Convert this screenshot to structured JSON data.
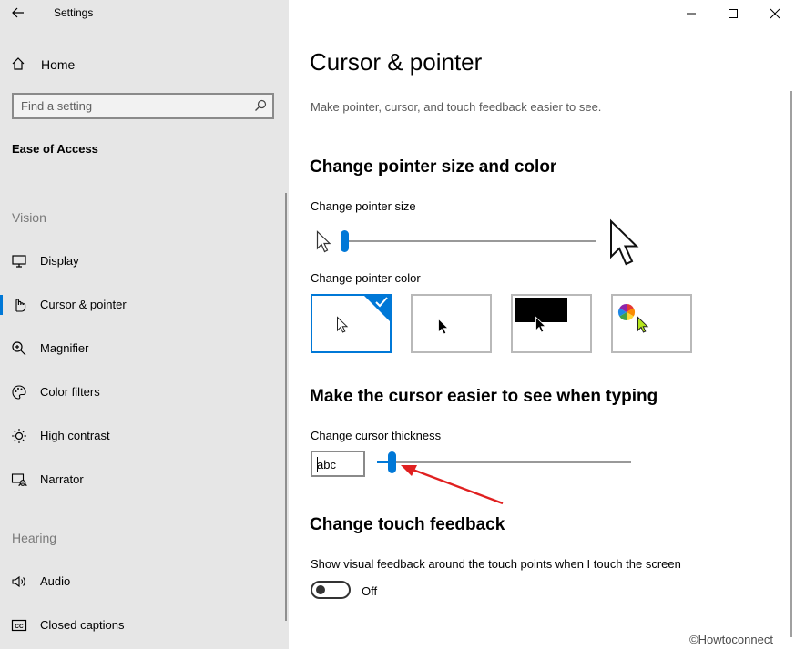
{
  "app": {
    "title": "Settings"
  },
  "sidebar": {
    "home_label": "Home",
    "search_placeholder": "Find a setting",
    "section_heading": "Ease of Access",
    "groups": [
      {
        "label": "Vision"
      },
      {
        "label": "Hearing"
      }
    ],
    "items": [
      {
        "label": "Display",
        "icon": "monitor-icon"
      },
      {
        "label": "Cursor & pointer",
        "icon": "pointer-hand-icon",
        "selected": true
      },
      {
        "label": "Magnifier",
        "icon": "magnifier-icon"
      },
      {
        "label": "Color filters",
        "icon": "palette-icon"
      },
      {
        "label": "High contrast",
        "icon": "sun-icon"
      },
      {
        "label": "Narrator",
        "icon": "narrator-icon"
      },
      {
        "label": "Audio",
        "icon": "speaker-icon"
      },
      {
        "label": "Closed captions",
        "icon": "cc-icon"
      }
    ]
  },
  "main": {
    "title": "Cursor & pointer",
    "description": "Make pointer, cursor, and touch feedback easier to see.",
    "pointer_section": {
      "title": "Change pointer size and color",
      "size_label": "Change pointer size",
      "size_value": 1,
      "color_label": "Change pointer color",
      "color_options": [
        {
          "name": "white",
          "selected": true
        },
        {
          "name": "black",
          "selected": false
        },
        {
          "name": "inverted",
          "selected": false
        },
        {
          "name": "custom",
          "selected": false
        }
      ]
    },
    "typing_section": {
      "title": "Make the cursor easier to see when typing",
      "thickness_label": "Change cursor thickness",
      "preview_text": "abc",
      "thickness_value": 1
    },
    "touch_section": {
      "title": "Change touch feedback",
      "feedback_label": "Show visual feedback around the touch points when I touch the screen",
      "toggle_state": "Off"
    }
  },
  "watermark": "©Howtoconnect",
  "colors": {
    "accent": "#0078d7",
    "sidebar_bg": "#e6e6e6",
    "annotation_arrow": "#e02020"
  }
}
